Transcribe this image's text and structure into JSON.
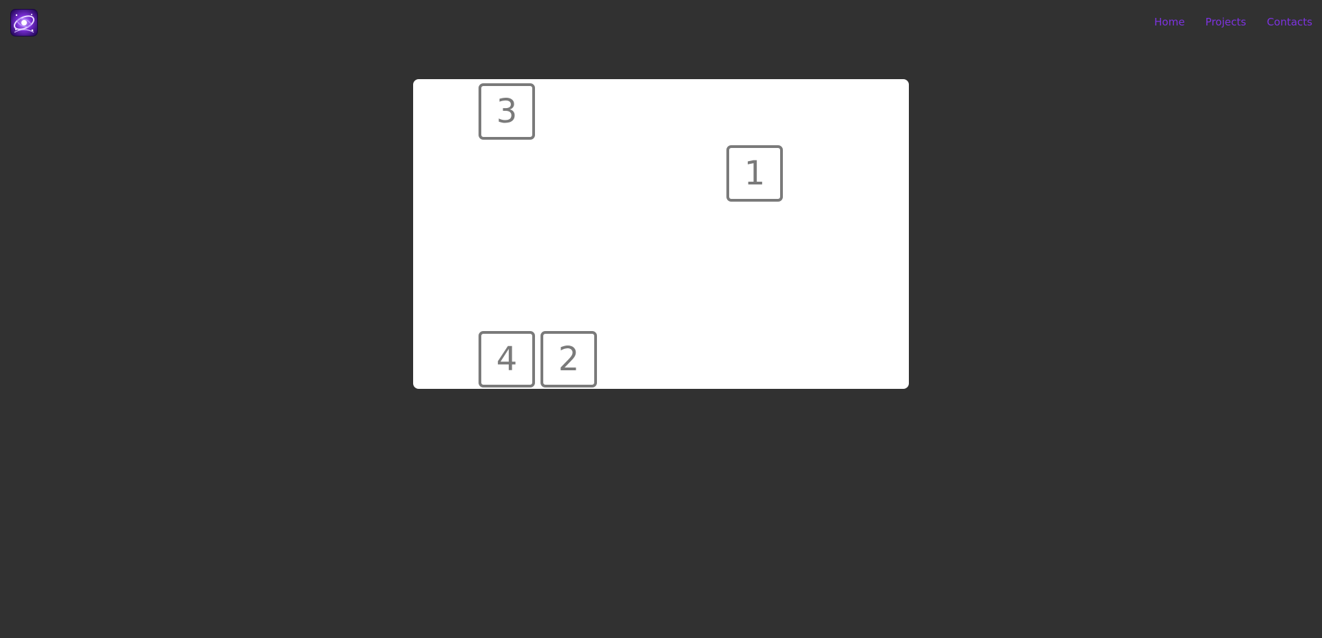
{
  "header": {
    "logo_icon": "galaxy-logo-icon",
    "nav": [
      {
        "label": "Home"
      },
      {
        "label": "Projects"
      },
      {
        "label": "Contacts"
      }
    ],
    "nav_color": "#7d32e0"
  },
  "board": {
    "tiles": [
      {
        "label": "3"
      },
      {
        "label": "1"
      },
      {
        "label": "4"
      },
      {
        "label": "2"
      }
    ],
    "tile_color": "#7a7a7a",
    "background": "#ffffff"
  },
  "page_background": "#313131"
}
